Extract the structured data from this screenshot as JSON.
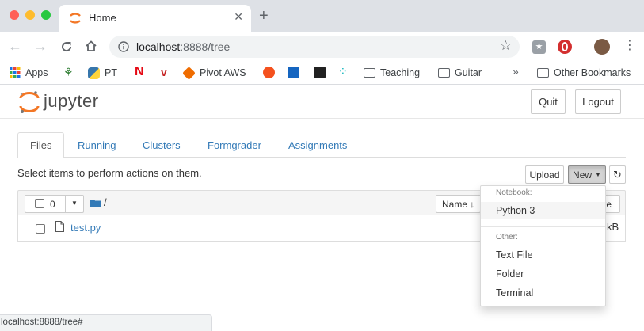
{
  "browser": {
    "tab_title": "Home",
    "url_host": "localhost",
    "url_rest": ":8888/tree",
    "bookmarks": [
      "Apps",
      "PT",
      "Pivot AWS",
      "Teaching",
      "Guitar",
      "»",
      "Other Bookmarks"
    ],
    "status_url": "localhost:8888/tree#"
  },
  "jupyter": {
    "logo_text": "jupyter",
    "quit_label": "Quit",
    "logout_label": "Logout",
    "tabs": [
      "Files",
      "Running",
      "Clusters",
      "Formgrader",
      "Assignments"
    ],
    "select_message": "Select items to perform actions on them.",
    "upload_label": "Upload",
    "new_label": "New",
    "selected_count": "0",
    "breadcrumb_path": "/",
    "name_sort_label": "Name",
    "size_header_fragment": "te",
    "files": [
      {
        "name": "test.py",
        "size_fragment": "kB"
      }
    ],
    "dropdown": {
      "notebook_header": "Notebook:",
      "notebook_items": [
        "Python 3"
      ],
      "other_header": "Other:",
      "other_items": [
        "Text File",
        "Folder",
        "Terminal"
      ]
    }
  },
  "colors": {
    "link": "#337ab7",
    "jupyter_orange": "#f37726",
    "chrome_tabstrip": "#dee1e6"
  }
}
